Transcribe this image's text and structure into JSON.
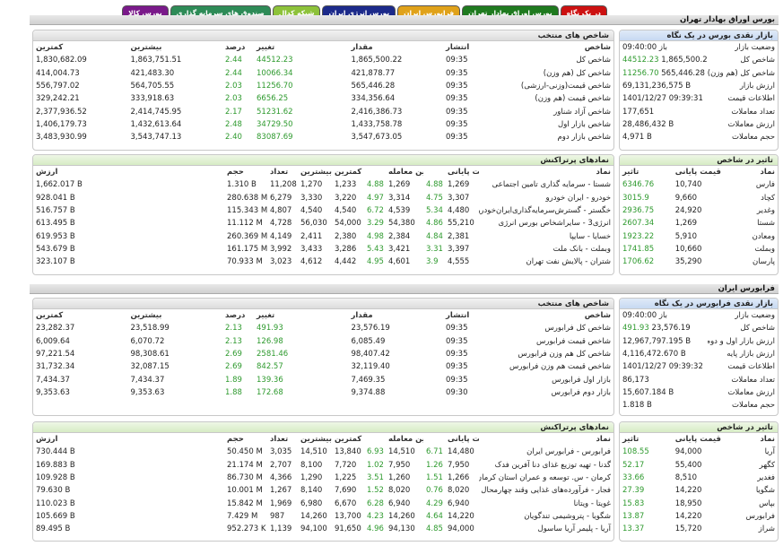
{
  "tabs": [
    {
      "label": "در یک نگاه",
      "bg": "#cc1111",
      "fg": "#ffffff"
    },
    {
      "label": "بورس اوراق بهادار تهران",
      "bg": "#1f7a1f",
      "fg": "#ffffff"
    },
    {
      "label": "فرابورس ایران",
      "bg": "#e0a21a",
      "fg": "#ffffff"
    },
    {
      "label": "بورس انرژی ایران",
      "bg": "#1c2a8a",
      "fg": "#ffffff"
    },
    {
      "label": "شبکه کدال",
      "bg": "#8dc23a",
      "fg": "#ffffff"
    },
    {
      "label": "صندوق های سرمایه گذاری",
      "bg": "#2e8b57",
      "fg": "#ffffff"
    },
    {
      "label": "بورس کالا",
      "bg": "#7a1a8a",
      "fg": "#ffffff"
    }
  ],
  "tse": {
    "title": "بورس اوراق بهادار تهران",
    "market": {
      "title": "بازار نقدی بورس در یک نگاه",
      "rows": [
        {
          "label": "وضعیت بازار",
          "value": "باز 09:40:00",
          "green": false
        },
        {
          "label": "شاخص کل",
          "value": "1,865,500.22",
          "change": "44512.23"
        },
        {
          "label": "شاخص کل (هم وزن)",
          "value": "565,446.28",
          "change": "11256.70"
        },
        {
          "label": "ارزش بازار",
          "value": "69,131,236,575 B"
        },
        {
          "label": "اطلاعات قیمت",
          "value": "1401/12/27 09:39:31"
        },
        {
          "label": "تعداد معاملات",
          "value": "177,651"
        },
        {
          "label": "ارزش معاملات",
          "value": "28,486,432 B"
        },
        {
          "label": "حجم معاملات",
          "value": "4,971 B"
        }
      ]
    },
    "indices": {
      "title": "شاخص های منتخب",
      "headers": [
        "شاخص",
        "انتشار",
        "مقدار",
        "تغییر",
        "درصد",
        "بیشترین",
        "کمترین"
      ],
      "rows": [
        [
          "شاخص کل",
          "09:35",
          "1,865,500.22",
          "44512.23",
          "2.44",
          "1,863,751.51",
          "1,830,682.09"
        ],
        [
          "شاخص کل (هم وزن)",
          "09:35",
          "421,878.77",
          "10066.34",
          "2.44",
          "421,483.30",
          "414,004.73"
        ],
        [
          "شاخص قیمت(وزنی-ارزشی)",
          "09:35",
          "565,446.28",
          "11256.70",
          "2.03",
          "564,705.55",
          "556,797.02"
        ],
        [
          "شاخص قیمت (هم وزن)",
          "09:35",
          "334,356.64",
          "6656.25",
          "2.03",
          "333,918.63",
          "329,242.21"
        ],
        [
          "شاخص آزاد شناور",
          "09:35",
          "2,416,386.73",
          "51231.62",
          "2.17",
          "2,414,745.95",
          "2,377,936.52"
        ],
        [
          "شاخص بازار اول",
          "09:35",
          "1,433,758.78",
          "34729.50",
          "2.48",
          "1,432,613.64",
          "1,406,179.73"
        ],
        [
          "شاخص بازار دوم",
          "09:35",
          "3,547,673.05",
          "83087.69",
          "2.40",
          "3,543,747.13",
          "3,483,930.99"
        ]
      ]
    },
    "impact": {
      "title": "تاثیر در شاخص",
      "headers": [
        "نماد",
        "قیمت پایانی",
        "تاثیر"
      ],
      "rows": [
        [
          "فارس",
          "10,740",
          "6346.76"
        ],
        [
          "کچاد",
          "9,660",
          "3015.9"
        ],
        [
          "وغدیر",
          "24,920",
          "2936.75"
        ],
        [
          "شستا",
          "1,269",
          "2607.34"
        ],
        [
          "ومعادن",
          "5,910",
          "1923.22"
        ],
        [
          "وبملت",
          "10,660",
          "1741.85"
        ],
        [
          "پارسان",
          "35,290",
          "1706.62"
        ]
      ]
    },
    "symbols": {
      "title": "نمادهای پرتراکنش",
      "headers": [
        "نماد",
        "قیمت پایانی",
        "",
        "آخرین معامله",
        "",
        "کمترین",
        "بیشترین",
        "تعداد",
        "حجم",
        "ارزش"
      ],
      "rows": [
        [
          "شستا - سرمایه گذاری تامین اجتماعی",
          "1,269",
          "4.88",
          "1,269",
          "4.88",
          "1,233",
          "1,270",
          "11,208",
          "1.310 B",
          "1,662.017 B"
        ],
        [
          "خودرو - ایران خودرو",
          "3,307",
          "4.75",
          "3,314",
          "4.97",
          "3,220",
          "3,330",
          "6,279",
          "280.638 M",
          "928.041 B"
        ],
        [
          "خگستر - گسترش‌سرمایه‌گذاری‌ایران‌خودرو",
          "4,480",
          "5.34",
          "4,539",
          "6.72",
          "4,540",
          "4,540",
          "4,807",
          "115.343 M",
          "516.757 B"
        ],
        [
          "انرژی3 - سایراشخاص بورس انرژی",
          "55,210",
          "4.86",
          "54,380",
          "3.29",
          "54,000",
          "56,030",
          "4,728",
          "11.112 M",
          "613.495 B"
        ],
        [
          "خسایا - سایپا",
          "2,381",
          "4.84",
          "2,384",
          "4.98",
          "2,380",
          "2,411",
          "4,149",
          "260.369 M",
          "619.953 B"
        ],
        [
          "وبملت - بانک ملت",
          "3,397",
          "3.31",
          "3,421",
          "5.43",
          "3,286",
          "3,433",
          "3,992",
          "161.175 M",
          "543.679 B"
        ],
        [
          "شتران - پالایش نفت تهران",
          "4,555",
          "3.9",
          "4,601",
          "4.95",
          "4,442",
          "4,612",
          "3,023",
          "70.933 M",
          "323.107 B"
        ]
      ]
    }
  },
  "ifb": {
    "title": "فرابورس ایران",
    "market": {
      "title": "بازار نقدی فرابورس در یک نگاه",
      "rows": [
        {
          "label": "وضعیت بازار",
          "value": "باز 09:40:00"
        },
        {
          "label": "شاخص کل",
          "value": "23,576.19",
          "change": "491.93"
        },
        {
          "label": "ارزش بازار اول و دوم",
          "value": "12,967,797.195 B"
        },
        {
          "label": "ارزش بازار پایه",
          "value": "4,116,472.670 B"
        },
        {
          "label": "اطلاعات قیمت",
          "value": "1401/12/27 09:39:32"
        },
        {
          "label": "تعداد معاملات",
          "value": "86,173"
        },
        {
          "label": "ارزش معاملات",
          "value": "15,607.184 B"
        },
        {
          "label": "حجم معاملات",
          "value": "1.818 B"
        }
      ]
    },
    "indices": {
      "title": "شاخص های منتخب",
      "headers": [
        "شاخص",
        "انتشار",
        "مقدار",
        "تغییر",
        "درصد",
        "بیشترین",
        "کمترین"
      ],
      "rows": [
        [
          "شاخص کل فرابورس",
          "09:35",
          "23,576.19",
          "491.93",
          "2.13",
          "23,518.99",
          "23,282.37"
        ],
        [
          "شاخص قیمت فرابورس",
          "09:35",
          "6,085.49",
          "126.98",
          "2.13",
          "6,070.72",
          "6,009.64"
        ],
        [
          "شاخص کل هم وزن فرابورس",
          "09:35",
          "98,407.42",
          "2581.46",
          "2.69",
          "98,308.61",
          "97,221.54"
        ],
        [
          "شاخص قیمت هم وزن فرابورس",
          "09:35",
          "32,119.40",
          "842.57",
          "2.69",
          "32,087.15",
          "31,732.34"
        ],
        [
          "بازار اول فرابورس",
          "09:35",
          "7,469.35",
          "139.36",
          "1.89",
          "7,434.37",
          "7,434.37"
        ],
        [
          "بازار دوم فرابورس",
          "09:30",
          "9,374.88",
          "172.68",
          "1.88",
          "9,353.63",
          "9,353.63"
        ]
      ]
    },
    "impact": {
      "title": "تاثیر در شاخص",
      "headers": [
        "نماد",
        "قیمت پایانی",
        "تاثیر"
      ],
      "rows": [
        [
          "آریا",
          "94,000",
          "108.55"
        ],
        [
          "کگهر",
          "55,400",
          "52.17"
        ],
        [
          "فغدیر",
          "8,510",
          "33.66"
        ],
        [
          "شگویا",
          "14,220",
          "27.39"
        ],
        [
          "بپاس",
          "18,950",
          "15.83"
        ],
        [
          "فرابورس",
          "14,220",
          "13.87"
        ],
        [
          "شراز",
          "15,720",
          "13.37"
        ]
      ]
    },
    "symbols": {
      "title": "نمادهای پرتراکنش",
      "headers": [
        "نماد",
        "قیمت پایانی",
        "",
        "آخرین معامله",
        "",
        "کمترین",
        "بیشترین",
        "تعداد",
        "حجم",
        "ارزش"
      ],
      "rows": [
        [
          "فرابورس - فرابورس ایران",
          "14,480",
          "6.71",
          "14,510",
          "6.93",
          "13,840",
          "14,510",
          "3,035",
          "50.450 M",
          "730.444 B"
        ],
        [
          "گدنا - تهیه توزیع غذای دنا آفرین فدک",
          "7,950",
          "1.26",
          "7,950",
          "1.02",
          "7,720",
          "8,100",
          "2,707",
          "21.174 M",
          "169.883 B"
        ],
        [
          "کرمان - س. توسعه و عمران استان کرمان",
          "1,266",
          "1.51",
          "1,260",
          "3.51",
          "1,225",
          "1,290",
          "4,366",
          "86.730 M",
          "109.928 B"
        ],
        [
          "فجار - فرآورده‌های غذایی وقند چهارمحال",
          "8,020",
          "0.76",
          "8,020",
          "1.52",
          "7,690",
          "8,140",
          "1,267",
          "10.001 M",
          "79.630 B"
        ],
        [
          "غویتا - ویتانا",
          "6,940",
          "4.29",
          "6,940",
          "6.28",
          "6,670",
          "6,980",
          "1,969",
          "15.842 M",
          "110.023 B"
        ],
        [
          "شگویا - پتروشیمی تندگویان",
          "14,220",
          "4.64",
          "14,260",
          "4.23",
          "13,700",
          "14,260",
          "987",
          "7.429 M",
          "105.669 B"
        ],
        [
          "آریا - پلیمر آریا ساسول",
          "94,000",
          "4.85",
          "94,130",
          "4.96",
          "91,650",
          "94,100",
          "1,139",
          "952.273 K",
          "89.495 B"
        ]
      ]
    }
  }
}
